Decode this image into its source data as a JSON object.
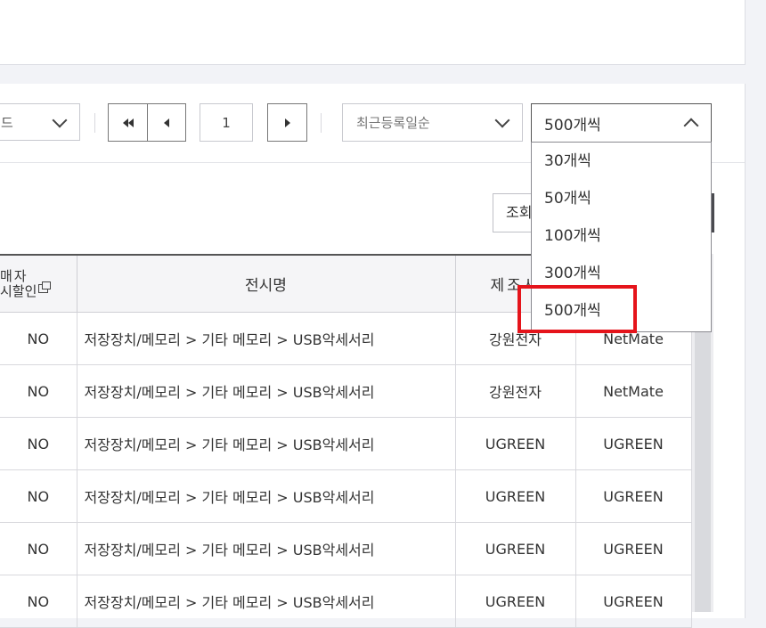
{
  "toolbar": {
    "partial_select_text": "드",
    "page_number": "1",
    "sort_label": "최근등록일순",
    "per_page_selected": "500개씩"
  },
  "per_page_options": [
    {
      "label": "30개씩"
    },
    {
      "label": "50개씩"
    },
    {
      "label": "100개씩"
    },
    {
      "label": "300개씩"
    },
    {
      "label": "500개씩"
    }
  ],
  "search_button_label": "조회",
  "table": {
    "headers": {
      "col1_line1": "매자",
      "col1_line2": "시할인",
      "col2": "전시명",
      "col3": "제조사",
      "col4": ""
    },
    "rows": [
      {
        "c1": "NO",
        "c2": "저장장치/메모리 > 기타 메모리 > USB악세서리",
        "c3": "강원전자",
        "c4": "NetMate"
      },
      {
        "c1": "NO",
        "c2": "저장장치/메모리 > 기타 메모리 > USB악세서리",
        "c3": "강원전자",
        "c4": "NetMate"
      },
      {
        "c1": "NO",
        "c2": "저장장치/메모리 > 기타 메모리 > USB악세서리",
        "c3": "UGREEN",
        "c4": "UGREEN"
      },
      {
        "c1": "NO",
        "c2": "저장장치/메모리 > 기타 메모리 > USB악세서리",
        "c3": "UGREEN",
        "c4": "UGREEN"
      },
      {
        "c1": "NO",
        "c2": "저장장치/메모리 > 기타 메모리 > USB악세서리",
        "c3": "UGREEN",
        "c4": "UGREEN"
      },
      {
        "c1": "NO",
        "c2": "저장장치/메모리 > 기타 메모리 > USB악세서리",
        "c3": "UGREEN",
        "c4": "UGREEN"
      }
    ]
  },
  "colors": {
    "highlight": "#e5141b",
    "header_border": "#555555",
    "panel_bg": "#ffffff",
    "page_bg": "#f2f3f7"
  }
}
